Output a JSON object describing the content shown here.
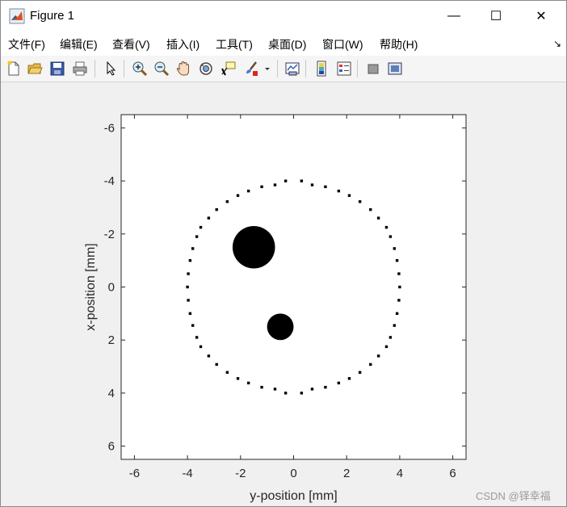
{
  "window": {
    "title": "Figure 1",
    "controls": {
      "minimize": "—",
      "maximize": "☐",
      "close": "✕"
    }
  },
  "menubar": {
    "items": [
      "文件(F)",
      "编辑(E)",
      "查看(V)",
      "插入(I)",
      "工具(T)",
      "桌面(D)",
      "窗口(W)",
      "帮助(H)"
    ],
    "dock_arrow": "↘"
  },
  "toolbar": {
    "buttons": [
      "new-figure-icon",
      "open-file-icon",
      "save-icon",
      "print-icon",
      "select-arrow-icon",
      "zoom-in-icon",
      "zoom-out-icon",
      "pan-hand-icon",
      "rotate-3d-icon",
      "data-cursor-icon",
      "brush-icon",
      "brush-dropdown-icon",
      "link-plot-icon",
      "colorbar-icon",
      "legend-icon",
      "hide-plot-tools-icon",
      "show-plot-tools-icon"
    ]
  },
  "chart_data": {
    "type": "scatter",
    "xlabel": "y-position [mm]",
    "ylabel": "x-position [mm]",
    "xlim": [
      -6.5,
      6.5
    ],
    "ylim": [
      -6.5,
      6.5
    ],
    "y_reversed": true,
    "xticks": [
      -6,
      -4,
      -2,
      0,
      2,
      4,
      6
    ],
    "yticks": [
      -6,
      -4,
      -2,
      0,
      2,
      4,
      6
    ],
    "xtick_labels": [
      "-6",
      "-4",
      "-2",
      "0",
      "2",
      "4",
      "6"
    ],
    "ytick_labels": [
      "-6",
      "-4",
      "-2",
      "0",
      "2",
      "4",
      "6"
    ],
    "grid": false,
    "series": [
      {
        "marker": "small-square",
        "color": "#000000",
        "points": [
          [
            -0.3,
            -4.0
          ],
          [
            0.3,
            -4.0
          ],
          [
            -0.7,
            -3.85
          ],
          [
            0.7,
            -3.85
          ],
          [
            -1.2,
            -3.78
          ],
          [
            1.2,
            -3.78
          ],
          [
            -1.7,
            -3.62
          ],
          [
            1.7,
            -3.62
          ],
          [
            -2.1,
            -3.45
          ],
          [
            2.1,
            -3.45
          ],
          [
            -2.5,
            -3.22
          ],
          [
            2.5,
            -3.22
          ],
          [
            -2.9,
            -2.92
          ],
          [
            2.9,
            -2.92
          ],
          [
            -3.2,
            -2.6
          ],
          [
            3.2,
            -2.6
          ],
          [
            -3.5,
            -2.25
          ],
          [
            3.5,
            -2.25
          ],
          [
            -3.65,
            -1.9
          ],
          [
            3.65,
            -1.9
          ],
          [
            -3.8,
            -1.45
          ],
          [
            3.8,
            -1.45
          ],
          [
            -3.9,
            -1.0
          ],
          [
            3.9,
            -1.0
          ],
          [
            -3.97,
            -0.5
          ],
          [
            3.97,
            -0.5
          ],
          [
            -4.0,
            0.0
          ],
          [
            4.0,
            0.0
          ],
          [
            -3.97,
            0.5
          ],
          [
            3.97,
            0.5
          ],
          [
            -3.9,
            1.0
          ],
          [
            3.9,
            1.0
          ],
          [
            -3.8,
            1.45
          ],
          [
            3.8,
            1.45
          ],
          [
            -3.65,
            1.9
          ],
          [
            3.65,
            1.9
          ],
          [
            -3.5,
            2.25
          ],
          [
            3.5,
            2.25
          ],
          [
            -3.2,
            2.6
          ],
          [
            3.2,
            2.6
          ],
          [
            -2.9,
            2.92
          ],
          [
            2.9,
            2.92
          ],
          [
            -2.5,
            3.22
          ],
          [
            2.5,
            3.22
          ],
          [
            -2.1,
            3.45
          ],
          [
            2.1,
            3.45
          ],
          [
            -1.7,
            3.62
          ],
          [
            1.7,
            3.62
          ],
          [
            -1.2,
            3.78
          ],
          [
            1.2,
            3.78
          ],
          [
            -0.7,
            3.85
          ],
          [
            0.7,
            3.85
          ],
          [
            -0.3,
            4.0
          ],
          [
            0.3,
            4.0
          ]
        ]
      }
    ],
    "inclusions": [
      {
        "center": [
          -1.5,
          -1.5
        ],
        "radius": 0.8,
        "color": "#000000"
      },
      {
        "center": [
          -0.5,
          1.5
        ],
        "radius": 0.5,
        "color": "#000000"
      }
    ]
  },
  "watermark": "CSDN @铎幸福"
}
